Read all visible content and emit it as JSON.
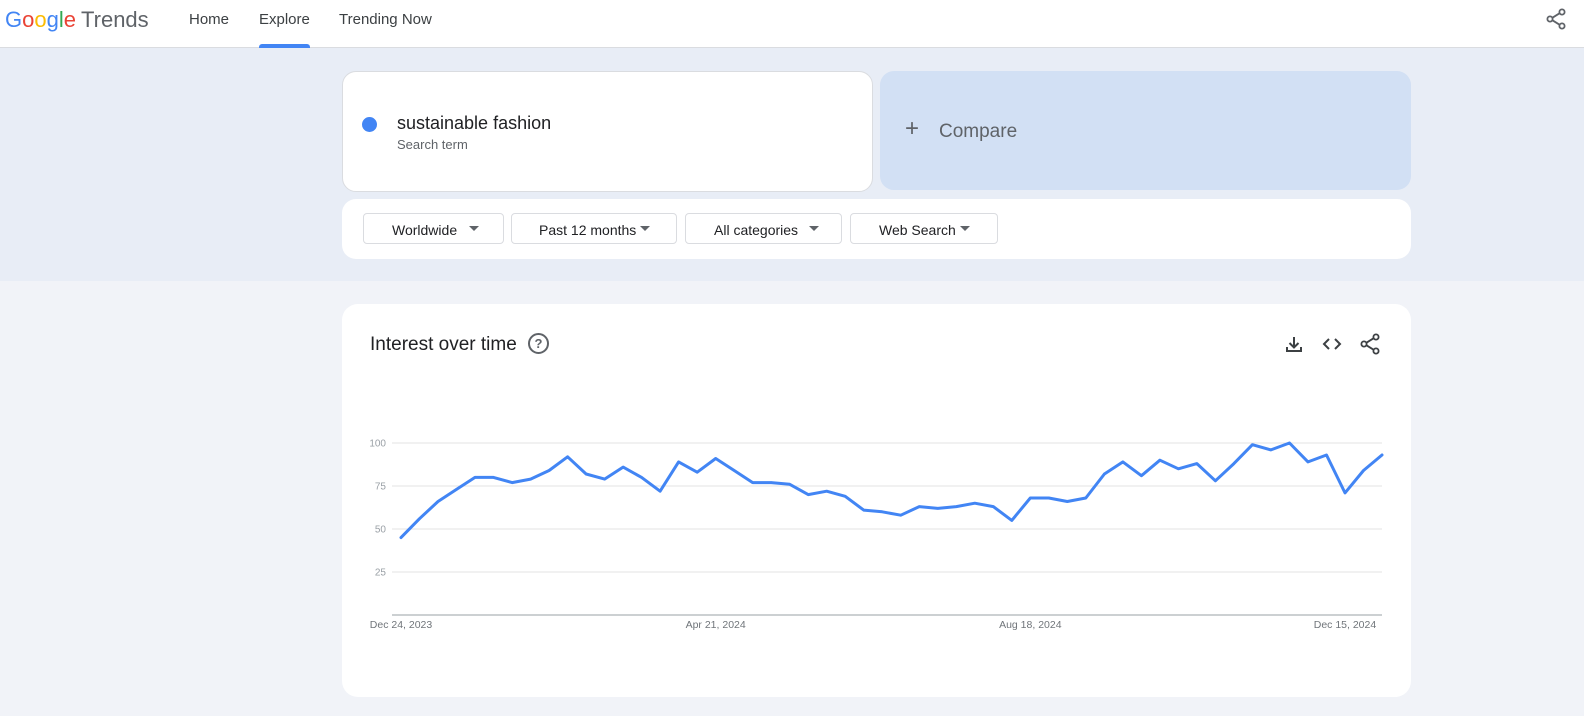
{
  "app": {
    "logo_google": [
      "G",
      "o",
      "o",
      "g",
      "l",
      "e"
    ],
    "logo_trends": "Trends"
  },
  "nav": {
    "home": "Home",
    "explore": "Explore",
    "trending_now": "Trending Now"
  },
  "search_term": {
    "name": "sustainable fashion",
    "type": "Search term",
    "color": "#4285f4"
  },
  "compare": {
    "icon": "plus-icon",
    "label": "Compare"
  },
  "filters": {
    "region": "Worldwide",
    "time": "Past 12 months",
    "category": "All categories",
    "property": "Web Search"
  },
  "interest_card": {
    "title": "Interest over time",
    "icons": [
      "help-icon",
      "download-icon",
      "embed-code-icon",
      "share-icon"
    ]
  },
  "chart_data": {
    "type": "line",
    "title": "Interest over time",
    "xlabel": "",
    "ylabel": "",
    "ylim": [
      0,
      100
    ],
    "yticks": [
      25,
      50,
      75,
      100
    ],
    "x_tick_labels": [
      "Dec 24, 2023",
      "Apr 21, 2024",
      "Aug 18, 2024",
      "Dec 15, 2024"
    ],
    "x_tick_indices": [
      0,
      17,
      34,
      51
    ],
    "grid": true,
    "series": [
      {
        "color": "#4285f4",
        "values": [
          45,
          56,
          66,
          73,
          80,
          80,
          77,
          79,
          84,
          92,
          82,
          79,
          86,
          80,
          72,
          89,
          83,
          91,
          84,
          77,
          77,
          76,
          70,
          72,
          69,
          61,
          60,
          58,
          63,
          62,
          63,
          65,
          63,
          55,
          68,
          68,
          66,
          68,
          82,
          89,
          81,
          90,
          85,
          88,
          78,
          88,
          99,
          96,
          100,
          89,
          93,
          71,
          84,
          93
        ]
      }
    ]
  }
}
